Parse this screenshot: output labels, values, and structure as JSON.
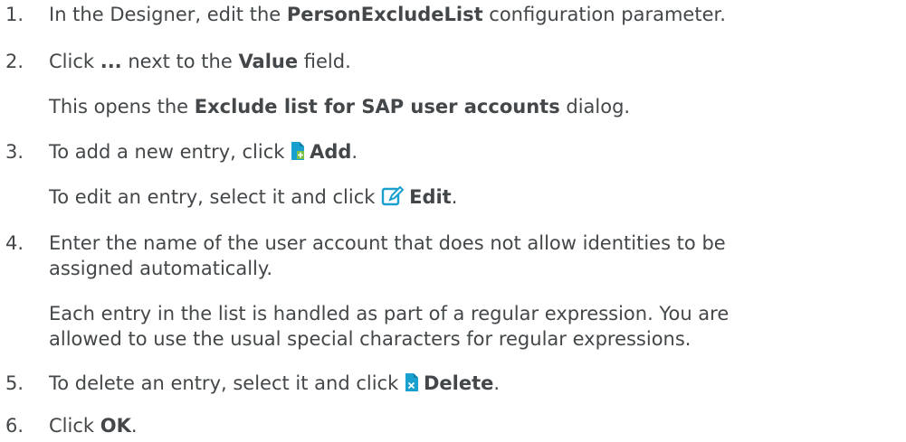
{
  "steps": [
    {
      "number": "1.",
      "text": [
        "In the Designer, edit the ",
        "PersonExcludeList",
        " configuration parameter."
      ]
    },
    {
      "number": "2.",
      "text": [
        "Click ",
        "...",
        " next to the ",
        "Value",
        " field."
      ],
      "note": [
        "This opens the ",
        "Exclude list for SAP user accounts",
        " dialog."
      ]
    },
    {
      "number": "3.",
      "text": [
        "To add a new entry, click ",
        "Add",
        "."
      ],
      "text_icon": "add-document-icon",
      "note": [
        "To edit an entry, select it and click ",
        "Edit",
        "."
      ],
      "note_icon": "edit-icon"
    },
    {
      "number": "4.",
      "text_line1": "Enter the name of the user account that does not allow identities to be",
      "text_line2": "assigned automatically.",
      "note_line1": "Each entry in the list is handled as part of a regular expression. You are",
      "note_line2": "allowed to use the usual special characters for regular expressions."
    },
    {
      "number": "5.",
      "text": [
        "To delete an entry, select it and click ",
        "Delete",
        "."
      ],
      "text_icon": "delete-document-icon"
    },
    {
      "number": "6.",
      "text": [
        "Click ",
        "OK",
        "."
      ]
    }
  ],
  "colors": {
    "text": "#434749",
    "icon_teal": "#1aa0cf",
    "icon_teal_dark": "#0f7fa8",
    "icon_badge": "#7ac143"
  }
}
